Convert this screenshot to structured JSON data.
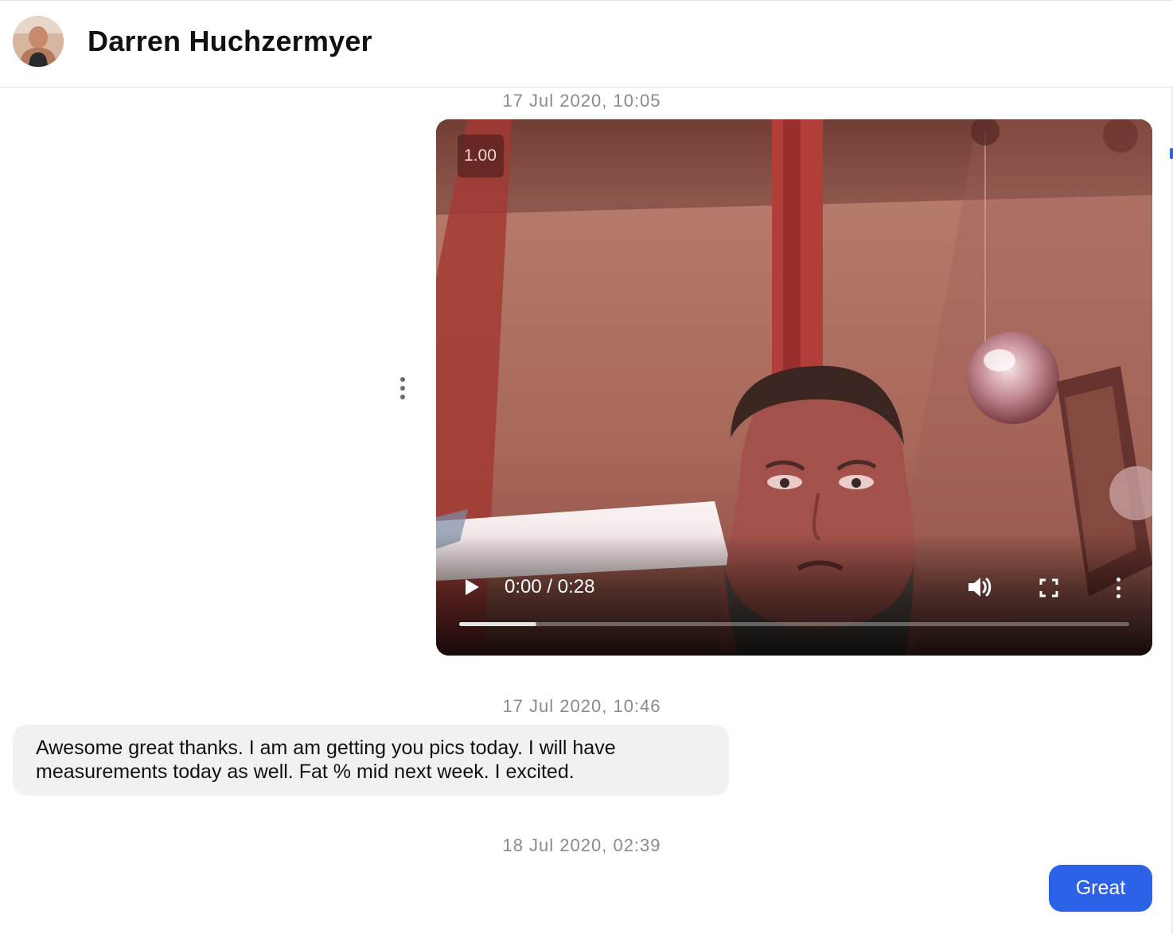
{
  "header": {
    "contact_name": "Darren Huchzermyer"
  },
  "messages": [
    {
      "timestamp": "17 Jul 2020, 10:05",
      "direction": "outgoing",
      "type": "video",
      "video": {
        "speed_label": "1.00",
        "time_display": "0:00 / 0:28",
        "progress_fraction": 0.115
      }
    },
    {
      "timestamp": "17 Jul 2020, 10:46",
      "direction": "incoming",
      "type": "text",
      "text": "Awesome great thanks. I am am getting you pics today. I will have measurements today as well. Fat % mid next week. I excited."
    },
    {
      "timestamp": "18 Jul 2020, 02:39",
      "direction": "outgoing",
      "type": "text",
      "text": "Great"
    }
  ],
  "icons": {
    "avatar": "contact-avatar-photo",
    "message_options": "vertical-ellipsis-icon",
    "play": "play-icon",
    "volume": "volume-icon",
    "fullscreen": "fullscreen-icon",
    "video_menu": "vertical-ellipsis-icon"
  },
  "colors": {
    "outgoing_bubble": "#2c62e8",
    "incoming_bubble": "#f0f1f3",
    "timestamp_text": "#8a8a8a"
  }
}
